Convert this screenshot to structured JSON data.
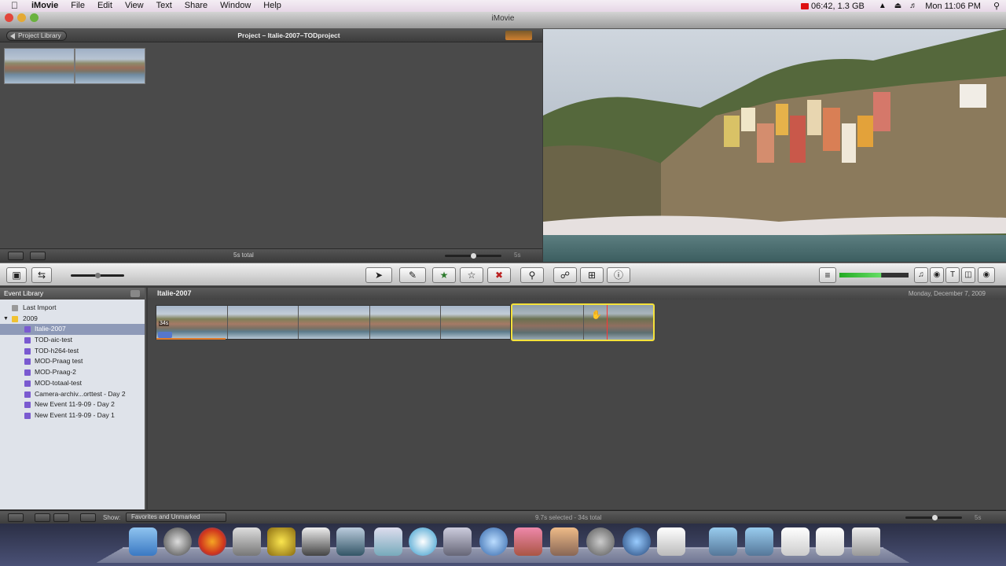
{
  "menubar": {
    "app": "iMovie",
    "items": [
      "File",
      "Edit",
      "View",
      "Text",
      "Share",
      "Window",
      "Help"
    ],
    "status": "06:42, 1.3 GB",
    "clock": "Mon 11:06 PM"
  },
  "window": {
    "title": "iMovie"
  },
  "project": {
    "back_label": "Project Library",
    "title": "Project – Italie-2007–TODproject",
    "total": "5s total",
    "zoom": "5s"
  },
  "event_library": {
    "header": "Event Library",
    "items": [
      {
        "label": "Last Import",
        "kind": "import"
      },
      {
        "label": "2009",
        "kind": "year"
      },
      {
        "label": "Italie-2007",
        "kind": "event",
        "selected": true
      },
      {
        "label": "TOD-aic-test",
        "kind": "event"
      },
      {
        "label": "TOD-h264-test",
        "kind": "event"
      },
      {
        "label": "MOD-Praag test",
        "kind": "event"
      },
      {
        "label": "MOD-Praag-2",
        "kind": "event"
      },
      {
        "label": "MOD-totaal-test",
        "kind": "event"
      },
      {
        "label": "Camera-archiv...orttest - Day 2",
        "kind": "event"
      },
      {
        "label": "New Event 11-9-09 - Day 2",
        "kind": "event"
      },
      {
        "label": "New Event 11-9-09 - Day 1",
        "kind": "event"
      }
    ]
  },
  "event_browser": {
    "title": "Italie-2007",
    "date": "Monday, December 7, 2009",
    "clip_duration": "34s"
  },
  "bottombar": {
    "show_label": "Show:",
    "filter": "Favorites and Unmarked",
    "status": "9.7s selected - 34s total",
    "zoom": "5s"
  },
  "toolbar": {
    "icons": [
      "arrow-tool",
      "keyword-tool",
      "mark-favorite",
      "unmark",
      "reject",
      "keyword",
      "voiceover",
      "crop",
      "inspector"
    ]
  },
  "colors": {
    "selection": "#f5e23a",
    "accent": "#8e9ab8"
  }
}
